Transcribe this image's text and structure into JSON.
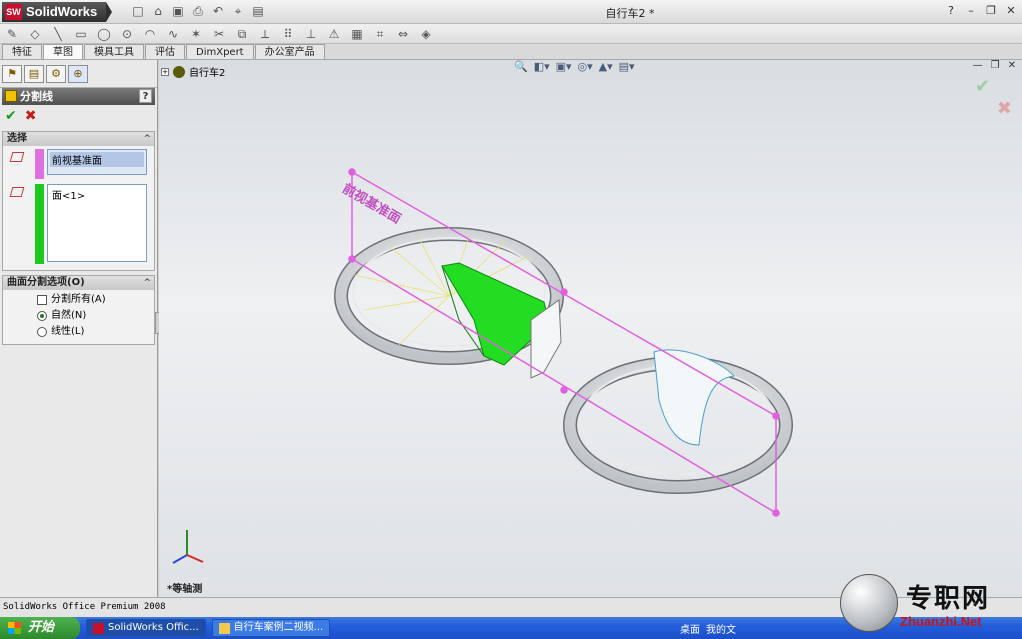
{
  "app": {
    "name": "SolidWorks",
    "document_title": "自行车2 *",
    "help_label": "?"
  },
  "command_tabs": [
    {
      "label": "特征",
      "active": false
    },
    {
      "label": "草图",
      "active": true
    },
    {
      "label": "模具工具",
      "active": false
    },
    {
      "label": "评估",
      "active": false
    },
    {
      "label": "DimXpert",
      "active": false
    },
    {
      "label": "办公室产品",
      "active": false
    }
  ],
  "property_manager": {
    "title": "分割线",
    "help": "?",
    "ok_icon": "✔",
    "cancel_icon": "✖",
    "selections_group": {
      "title": "选择",
      "collapse_icon": "^",
      "split_entity": "前视基准面",
      "faces": "面<1>"
    },
    "options_group": {
      "title": "曲面分割选项(O)",
      "collapse_icon": "^",
      "split_all_label": "分割所有(A)",
      "split_all_checked": false,
      "natural_label": "自然(N)",
      "natural_selected": true,
      "linear_label": "线性(L)",
      "linear_selected": false
    },
    "colors": {
      "split_entity_bar": "#e070e0",
      "faces_bar": "#1ec81e"
    }
  },
  "graphics": {
    "tree_root": "自行车2",
    "tree_expander": "+",
    "plane_label": "前视基准面",
    "view_label": "*等轴测",
    "colors": {
      "plane": "#e060e0",
      "selected_face": "#22dd22",
      "ring": "#ffffff"
    }
  },
  "status_bar": {
    "text": "SolidWorks Office Premium 2008"
  },
  "taskbar": {
    "start_label": "开始",
    "tasks": [
      {
        "label": "SolidWorks Offic...",
        "active": true
      },
      {
        "label": "自行车案例二视频...",
        "active": false
      }
    ],
    "tray_items": [
      "桌面",
      "我的文"
    ]
  },
  "watermark": {
    "cn": "专职网",
    "en": "Zhuanzhi.Net"
  }
}
